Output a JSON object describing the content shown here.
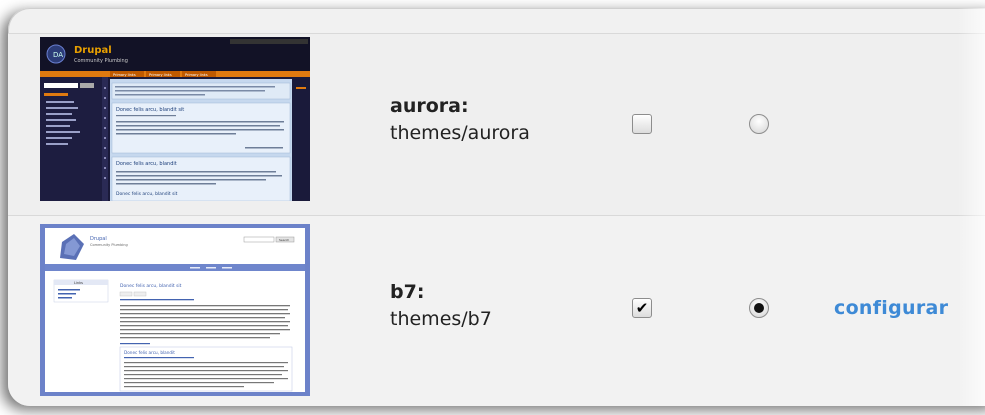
{
  "themes": [
    {
      "name": "aurora:",
      "path": "themes/aurora",
      "enabled": false,
      "default": false,
      "configure_label": "",
      "screenshot": {
        "site_name": "Drupal",
        "slogan": "Community Plumbing",
        "tabs": [
          "Primary links",
          "Primary links",
          "Primary links"
        ],
        "node_title": "Donec felis arcu, blandit sit",
        "colors": {
          "bg": "#1a1a3a",
          "header": "#101020",
          "accent": "#e07a10",
          "content": "#c9dbef"
        }
      }
    },
    {
      "name": "b7:",
      "path": "themes/b7",
      "enabled": true,
      "default": true,
      "configure_label": "configurar",
      "screenshot": {
        "site_name": "Drupal",
        "slogan": "Community Plumbing",
        "button": "Search",
        "menu_title": "Links",
        "node_title": "Donec felis arcu, blandit sit",
        "colors": {
          "frame": "#6c82c9",
          "bg": "#ffffff",
          "nav": "#6f86cc",
          "title": "#4363b0"
        }
      }
    }
  ],
  "colors": {
    "link": "#3e8ad6",
    "row_border": "#d9d9d9"
  }
}
